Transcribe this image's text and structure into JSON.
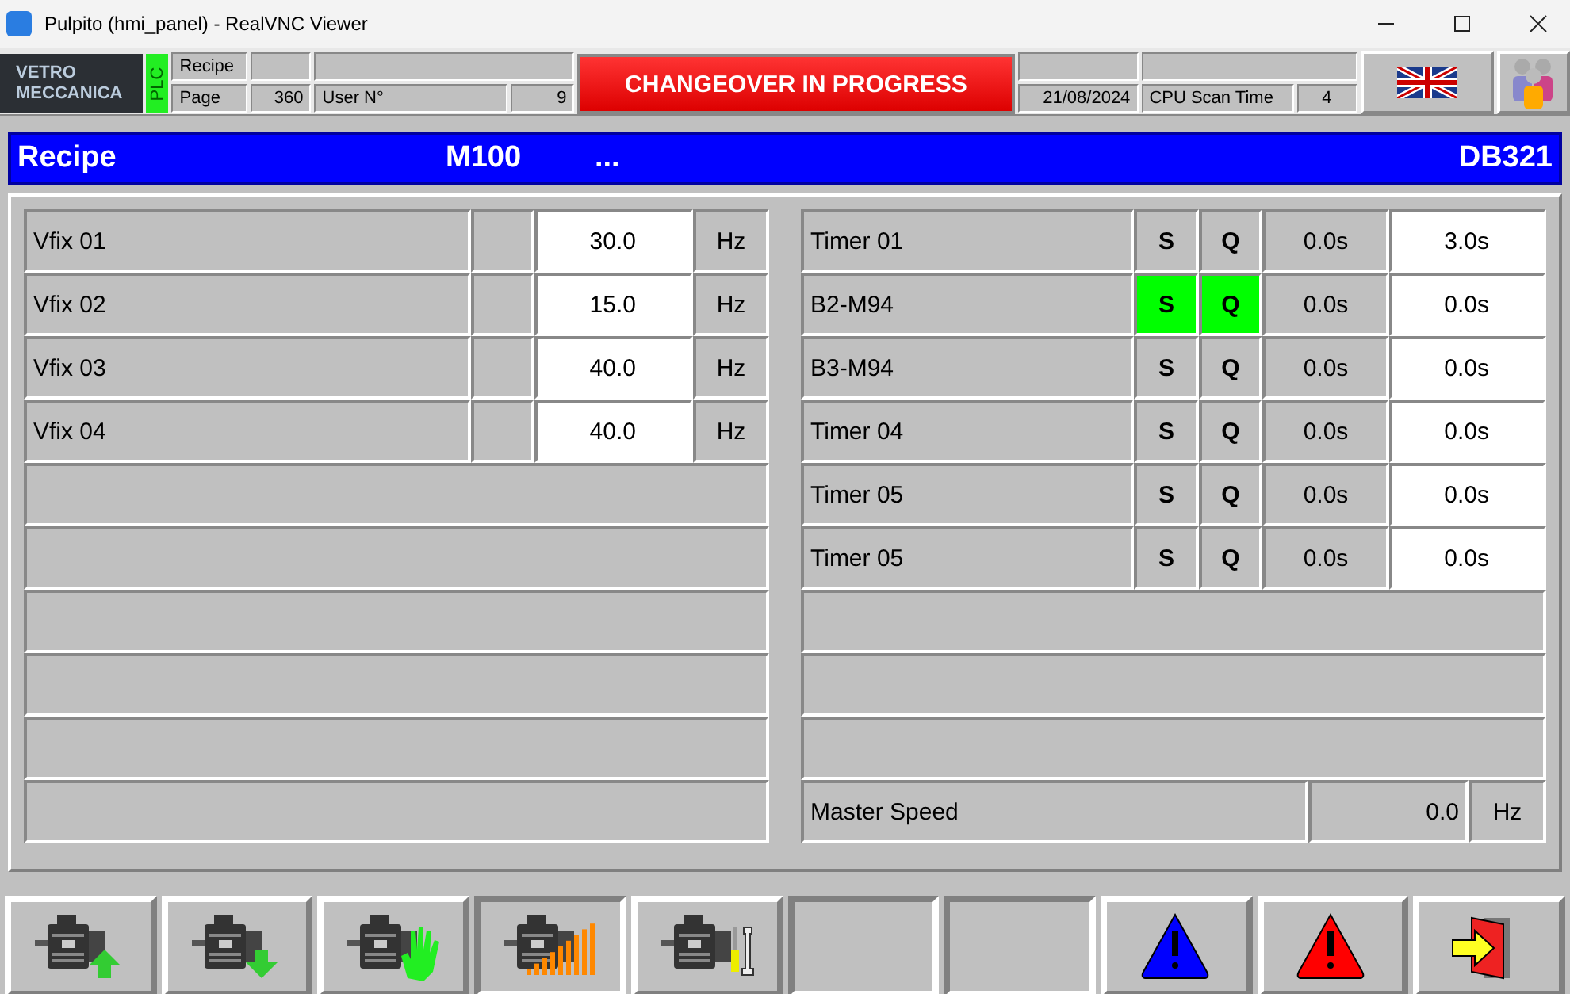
{
  "window": {
    "title": "Pulpito (hmi_panel) - RealVNC Viewer"
  },
  "header": {
    "logo_top": "VETRO",
    "logo_bottom": "MECCANICA",
    "plc": "PLC",
    "recipe_label": "Recipe",
    "page_label": "Page",
    "page": "360",
    "user_label": "User N°",
    "user": "9",
    "banner": "CHANGEOVER IN PROGRESS",
    "date": "21/08/2024",
    "cpu_label": "CPU Scan Time",
    "cpu": "4"
  },
  "recipe_bar": {
    "label": "Recipe",
    "code": "M100",
    "name": "...",
    "db": "DB321"
  },
  "setpoints": [
    {
      "name": "Vfix 01",
      "value": "30.0",
      "unit": "Hz"
    },
    {
      "name": "Vfix 02",
      "value": "15.0",
      "unit": "Hz"
    },
    {
      "name": "Vfix 03",
      "value": "40.0",
      "unit": "Hz"
    },
    {
      "name": "Vfix 04",
      "value": "40.0",
      "unit": "Hz"
    }
  ],
  "timers": [
    {
      "name": "Timer 01",
      "s": "S",
      "q": "Q",
      "s_active": false,
      "q_active": false,
      "elapsed": "0.0s",
      "preset": "3.0s"
    },
    {
      "name": "B2-M94",
      "s": "S",
      "q": "Q",
      "s_active": true,
      "q_active": true,
      "elapsed": "0.0s",
      "preset": "0.0s"
    },
    {
      "name": "B3-M94",
      "s": "S",
      "q": "Q",
      "s_active": false,
      "q_active": false,
      "elapsed": "0.0s",
      "preset": "0.0s"
    },
    {
      "name": "Timer 04",
      "s": "S",
      "q": "Q",
      "s_active": false,
      "q_active": false,
      "elapsed": "0.0s",
      "preset": "0.0s"
    },
    {
      "name": "Timer 05",
      "s": "S",
      "q": "Q",
      "s_active": false,
      "q_active": false,
      "elapsed": "0.0s",
      "preset": "0.0s"
    },
    {
      "name": "Timer 05",
      "s": "S",
      "q": "Q",
      "s_active": false,
      "q_active": false,
      "elapsed": "0.0s",
      "preset": "0.0s"
    }
  ],
  "master_speed": {
    "name": "Master Speed",
    "value": "0.0",
    "unit": "Hz"
  },
  "toolbar": [
    {
      "kind": "motor-up",
      "pressed": false
    },
    {
      "kind": "motor-down",
      "pressed": false
    },
    {
      "kind": "motor-hand",
      "pressed": false
    },
    {
      "kind": "motor-ramp",
      "pressed": true
    },
    {
      "kind": "motor-tools",
      "pressed": false
    },
    {
      "kind": "blank",
      "pressed": true
    },
    {
      "kind": "blank",
      "pressed": true
    },
    {
      "kind": "warn-blue",
      "pressed": false
    },
    {
      "kind": "warn-red",
      "pressed": false
    },
    {
      "kind": "exit",
      "pressed": false
    }
  ]
}
